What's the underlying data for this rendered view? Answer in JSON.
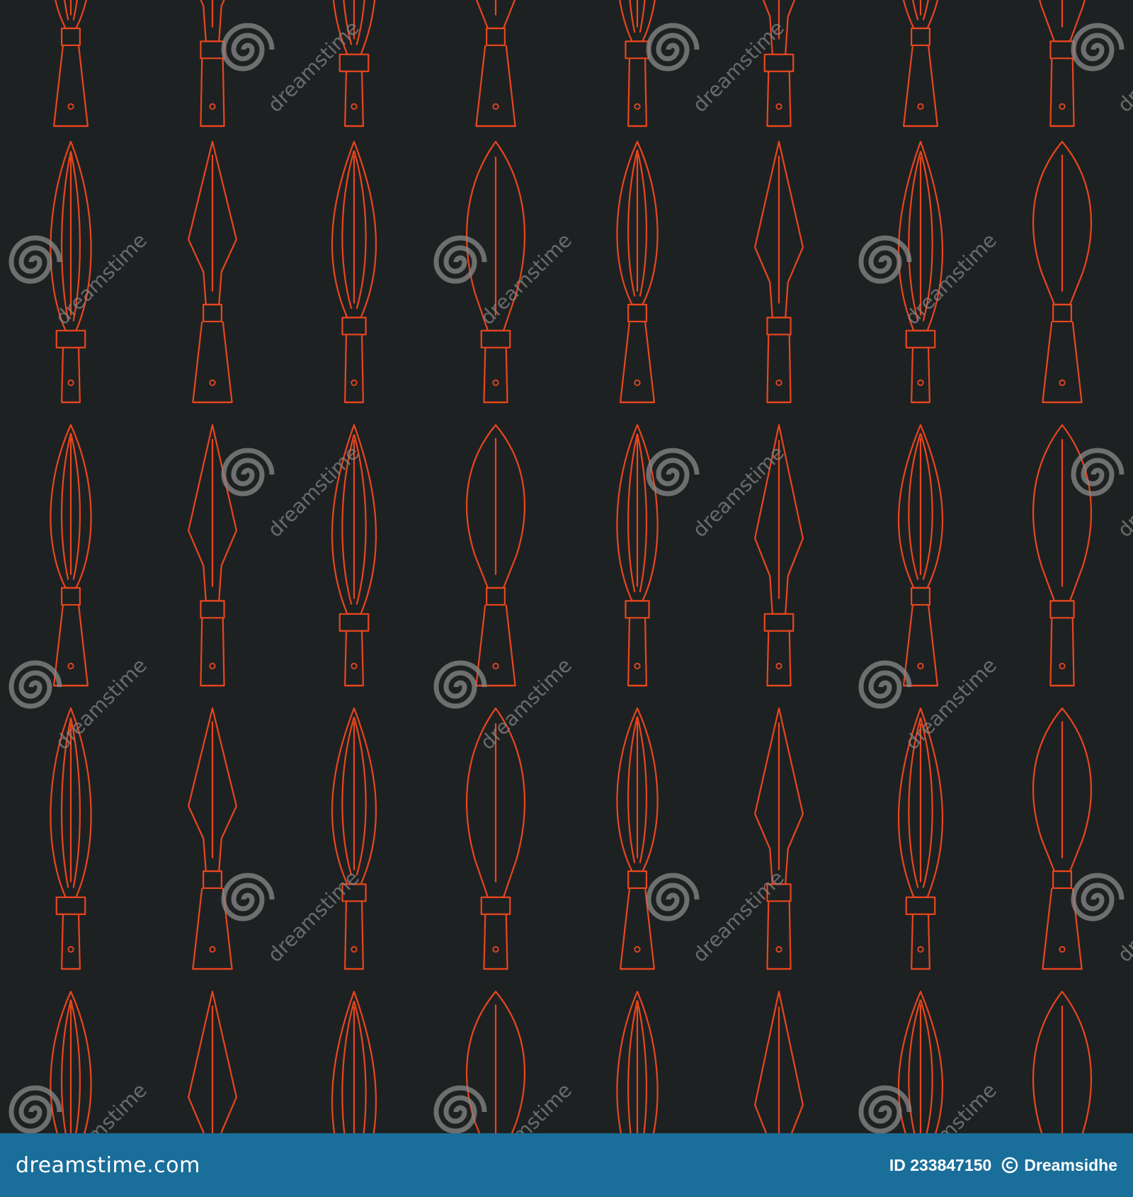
{
  "colors": {
    "background": "#1e2122",
    "stroke": "#e8461e",
    "footer": "#1a6e9a",
    "watermark": "#8a8a8a"
  },
  "pattern": {
    "motif": "spearhead-outline",
    "variant_count": 16
  },
  "watermark": {
    "text": "dreamstime",
    "icon": "swirl-icon"
  },
  "footer": {
    "brand": "dreamstime.com",
    "id_label": "ID 233847150",
    "author": "Dreamsidhe",
    "author_icon": "copyright-icon"
  }
}
